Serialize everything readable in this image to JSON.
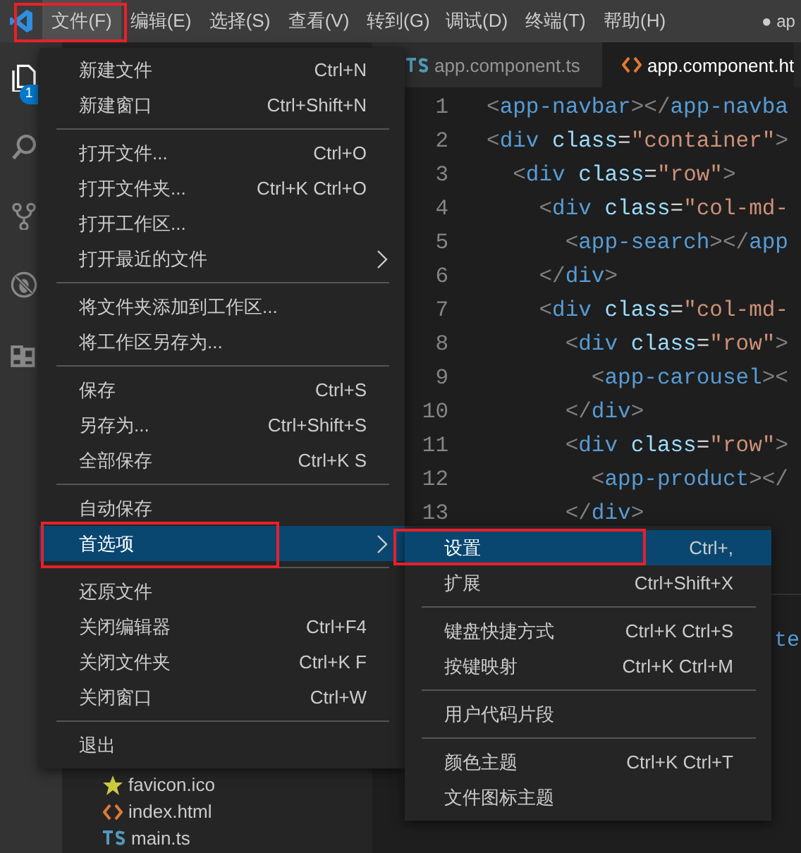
{
  "title_bar": {
    "menus": [
      {
        "label": "文件(F)",
        "selected": true
      },
      {
        "label": "编辑(E)",
        "selected": false
      },
      {
        "label": "选择(S)",
        "selected": false
      },
      {
        "label": "查看(V)",
        "selected": false
      },
      {
        "label": "转到(G)",
        "selected": false
      },
      {
        "label": "调试(D)",
        "selected": false
      },
      {
        "label": "终端(T)",
        "selected": false
      },
      {
        "label": "帮助(H)",
        "selected": false
      }
    ],
    "title": "● ap"
  },
  "activity_bar": {
    "badge": "1"
  },
  "sidebar": {
    "files": [
      {
        "name": "favicon.ico",
        "kind": "favicon"
      },
      {
        "name": "index.html",
        "kind": "html"
      },
      {
        "name": "main.ts",
        "kind": "ts"
      }
    ]
  },
  "editor": {
    "tabs": [
      {
        "label": "app.component.ts",
        "kind": "ts",
        "selected": false
      },
      {
        "label": "app.component.ht",
        "kind": "html",
        "selected": true
      }
    ],
    "lines": [
      {
        "number": "1",
        "code": "<app-navbar></app-navba"
      },
      {
        "number": "2",
        "code": "<div class=\"container\">"
      },
      {
        "number": "3",
        "code": "  <div class=\"row\">"
      },
      {
        "number": "4",
        "code": "    <div class=\"col-md-"
      },
      {
        "number": "5",
        "code": "      <app-search></app"
      },
      {
        "number": "6",
        "code": "    </div>"
      },
      {
        "number": "7",
        "code": "    <div class=\"col-md-"
      },
      {
        "number": "8",
        "code": "      <div class=\"row\">"
      },
      {
        "number": "9",
        "code": "        <app-carousel><"
      },
      {
        "number": "10",
        "code": "      </div>"
      },
      {
        "number": "11",
        "code": "      <div class=\"row\">"
      },
      {
        "number": "12",
        "code": "        <app-product></"
      },
      {
        "number": "13",
        "code": "      </div>"
      }
    ],
    "panel_text": "te"
  },
  "file_menu": {
    "groups": [
      [
        {
          "label": "新建文件",
          "shortcut": "Ctrl+N",
          "has_submenu": false,
          "selected": false
        },
        {
          "label": "新建窗口",
          "shortcut": "Ctrl+Shift+N",
          "has_submenu": false,
          "selected": false
        }
      ],
      [
        {
          "label": "打开文件...",
          "shortcut": "Ctrl+O",
          "has_submenu": false,
          "selected": false
        },
        {
          "label": "打开文件夹...",
          "shortcut": "Ctrl+K Ctrl+O",
          "has_submenu": false,
          "selected": false
        },
        {
          "label": "打开工作区...",
          "has_submenu": false,
          "selected": false
        },
        {
          "label": "打开最近的文件",
          "has_submenu": true,
          "selected": false
        }
      ],
      [
        {
          "label": "将文件夹添加到工作区...",
          "has_submenu": false,
          "selected": false
        },
        {
          "label": "将工作区另存为...",
          "has_submenu": false,
          "selected": false
        }
      ],
      [
        {
          "label": "保存",
          "shortcut": "Ctrl+S",
          "has_submenu": false,
          "selected": false
        },
        {
          "label": "另存为...",
          "shortcut": "Ctrl+Shift+S",
          "has_submenu": false,
          "selected": false
        },
        {
          "label": "全部保存",
          "shortcut": "Ctrl+K S",
          "has_submenu": false,
          "selected": false
        }
      ],
      [
        {
          "label": "自动保存",
          "has_submenu": false,
          "selected": false
        },
        {
          "label": "首选项",
          "has_submenu": true,
          "selected": true
        }
      ],
      [
        {
          "label": "还原文件",
          "has_submenu": false,
          "selected": false
        },
        {
          "label": "关闭编辑器",
          "shortcut": "Ctrl+F4",
          "has_submenu": false,
          "selected": false
        },
        {
          "label": "关闭文件夹",
          "shortcut": "Ctrl+K F",
          "has_submenu": false,
          "selected": false
        },
        {
          "label": "关闭窗口",
          "shortcut": "Ctrl+W",
          "has_submenu": false,
          "selected": false
        }
      ],
      [
        {
          "label": "退出",
          "has_submenu": false,
          "selected": false
        }
      ]
    ]
  },
  "preferences_submenu": {
    "groups": [
      [
        {
          "label": "设置",
          "shortcut": "Ctrl+,",
          "has_submenu": false,
          "selected": true
        },
        {
          "label": "扩展",
          "shortcut": "Ctrl+Shift+X",
          "has_submenu": false,
          "selected": false
        }
      ],
      [
        {
          "label": "键盘快捷方式",
          "shortcut": "Ctrl+K Ctrl+S",
          "has_submenu": false,
          "selected": false
        },
        {
          "label": "按键映射",
          "shortcut": "Ctrl+K Ctrl+M",
          "has_submenu": false,
          "selected": false
        }
      ],
      [
        {
          "label": "用户代码片段",
          "has_submenu": false,
          "selected": false
        }
      ],
      [
        {
          "label": "颜色主题",
          "shortcut": "Ctrl+K Ctrl+T",
          "has_submenu": false,
          "selected": false
        },
        {
          "label": "文件图标主题",
          "has_submenu": false,
          "selected": false
        }
      ]
    ]
  }
}
